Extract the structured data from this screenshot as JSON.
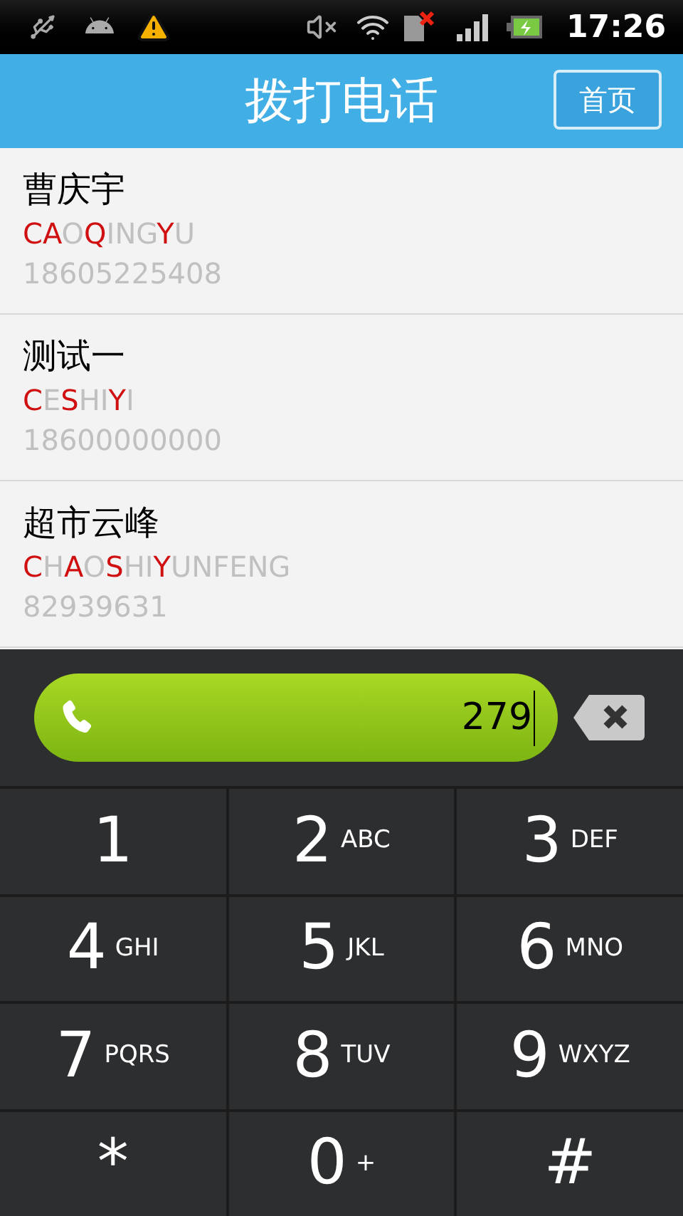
{
  "status_bar": {
    "time": "17:26"
  },
  "header": {
    "title": "拨打电话",
    "home_button": "首页"
  },
  "contacts": [
    {
      "name": "曹庆宇",
      "pinyin": [
        {
          "text": "CA",
          "matched": true
        },
        {
          "text": "O",
          "matched": false
        },
        {
          "text": "Q",
          "matched": true
        },
        {
          "text": "ING",
          "matched": false
        },
        {
          "text": "Y",
          "matched": true
        },
        {
          "text": "U",
          "matched": false
        }
      ],
      "number": "18605225408"
    },
    {
      "name": "测试一",
      "pinyin": [
        {
          "text": "C",
          "matched": true
        },
        {
          "text": "E",
          "matched": false
        },
        {
          "text": "S",
          "matched": true
        },
        {
          "text": "HI",
          "matched": false
        },
        {
          "text": "Y",
          "matched": true
        },
        {
          "text": "I",
          "matched": false
        }
      ],
      "number": "18600000000"
    },
    {
      "name": "超市云峰",
      "pinyin": [
        {
          "text": "C",
          "matched": true
        },
        {
          "text": "H",
          "matched": false
        },
        {
          "text": "A",
          "matched": true
        },
        {
          "text": "O",
          "matched": false
        },
        {
          "text": "S",
          "matched": true
        },
        {
          "text": "HI",
          "matched": false
        },
        {
          "text": "Y",
          "matched": true
        },
        {
          "text": "UNFENG",
          "matched": false
        }
      ],
      "number": "82939631"
    }
  ],
  "dial_field": {
    "value": "279"
  },
  "keypad": [
    {
      "digit": "1"
    },
    {
      "digit": "2",
      "letters": "ABC"
    },
    {
      "digit": "3",
      "letters": "DEF"
    },
    {
      "digit": "4",
      "letters": "GHI"
    },
    {
      "digit": "5",
      "letters": "JKL"
    },
    {
      "digit": "6",
      "letters": "MNO"
    },
    {
      "digit": "7",
      "letters": "PQRS"
    },
    {
      "digit": "8",
      "letters": "TUV"
    },
    {
      "digit": "9",
      "letters": "WXYZ"
    },
    {
      "digit": "*"
    },
    {
      "digit": "0",
      "letters": "+"
    },
    {
      "digit": "#"
    }
  ]
}
